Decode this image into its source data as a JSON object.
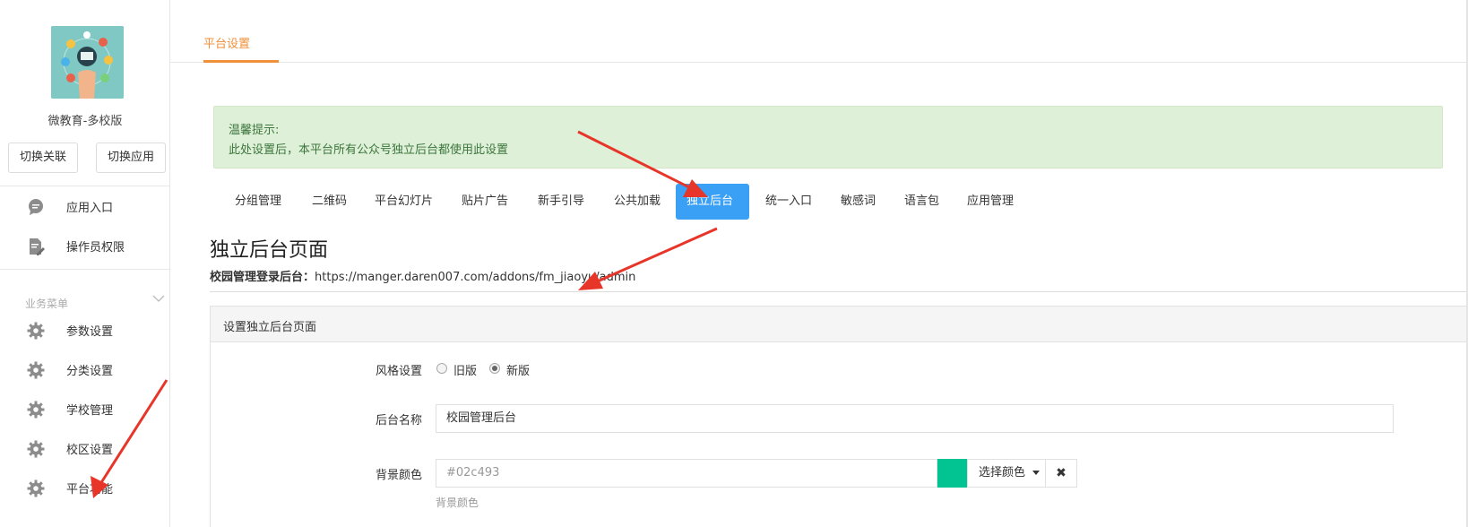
{
  "sidebar": {
    "app_name": "微教育-多校版",
    "btn_switch_link": "切换关联",
    "btn_switch_app": "切换应用",
    "top_items": [
      {
        "label": "应用入口",
        "icon": "chat-bubble-icon"
      },
      {
        "label": "操作员权限",
        "icon": "document-edit-icon"
      }
    ],
    "group_title": "业务菜单",
    "menu_items": [
      {
        "label": "参数设置",
        "icon": "gear-icon"
      },
      {
        "label": "分类设置",
        "icon": "gear-icon"
      },
      {
        "label": "学校管理",
        "icon": "gear-icon"
      },
      {
        "label": "校区设置",
        "icon": "gear-icon"
      },
      {
        "label": "平台功能",
        "icon": "gear-icon"
      }
    ]
  },
  "header": {
    "tab_label": "平台设置"
  },
  "alert": {
    "title": "温馨提示:",
    "message": "此处设置后，本平台所有公众号独立后台都使用此设置"
  },
  "subtabs": [
    "分组管理",
    "二维码",
    "平台幻灯片",
    "贴片广告",
    "新手引导",
    "公共加载",
    "独立后台",
    "统一入口",
    "敏感词",
    "语言包",
    "应用管理"
  ],
  "active_subtab": "独立后台",
  "page": {
    "title": "独立后台页面",
    "login_label": "校园管理登录后台：",
    "login_url": "https://manger.daren007.com/addons/fm_jiaoyu/admin"
  },
  "form": {
    "card_title": "设置独立后台页面",
    "style_label": "风格设置",
    "style_options": [
      "旧版",
      "新版"
    ],
    "style_selected": "新版",
    "name_label": "后台名称",
    "name_value": "校园管理后台",
    "bg_label": "背景颜色",
    "bg_value": "#02c493",
    "pick_color_label": "选择颜色",
    "clear_symbol": "✖",
    "bg_help": "背景颜色"
  },
  "colors": {
    "accent_orange": "#f0903a",
    "active_tab_blue": "#3aa0f5",
    "alert_bg": "#dff0d8",
    "alert_text": "#3c763d",
    "swatch": "#02c493",
    "annotation_red": "#e8352a"
  }
}
